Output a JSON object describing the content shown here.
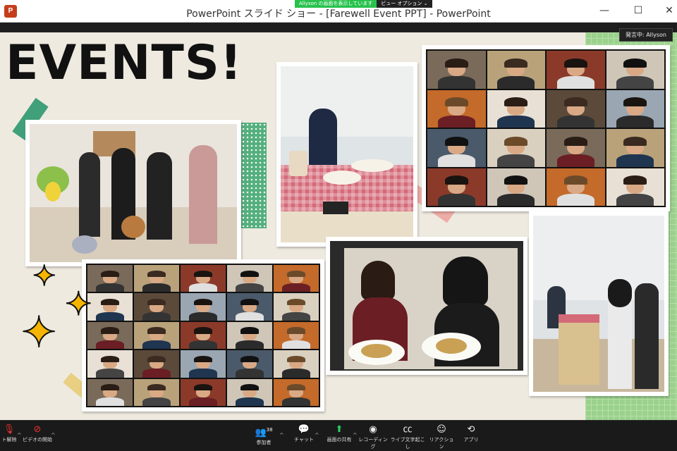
{
  "window": {
    "title": "PowerPoint スライド ショー - [Farewell Event PPT] - PowerPoint",
    "app_icon": "P",
    "minimize": "—",
    "maximize": "☐",
    "close": "✕"
  },
  "share_banner": {
    "status": "Allyson の画面を表示しています",
    "view_options": "ビュー オプション ⌄"
  },
  "speaker_label": "発言中: Allyson",
  "slide": {
    "heading": "EVENTS!"
  },
  "toolbar": {
    "items": [
      {
        "label": "ト解除",
        "icon": "microphone-icon"
      },
      {
        "label": "ビデオの開始",
        "icon": "video-off-icon"
      },
      {
        "label": "参加者",
        "icon": "participants-icon",
        "count": "38"
      },
      {
        "label": "チャット",
        "icon": "chat-icon"
      },
      {
        "label": "画面の共有",
        "icon": "share-screen-icon"
      },
      {
        "label": "レコーディング",
        "icon": "record-icon"
      },
      {
        "label": "ライブ文字起こし",
        "icon": "cc-icon"
      },
      {
        "label": "リアクション",
        "icon": "reaction-icon"
      },
      {
        "label": "アプリ",
        "icon": "apps-icon"
      }
    ]
  },
  "colors": {
    "share_green": "#27c24c",
    "ppt_red": "#c43e1c",
    "star_yellow": "#f5b400"
  }
}
